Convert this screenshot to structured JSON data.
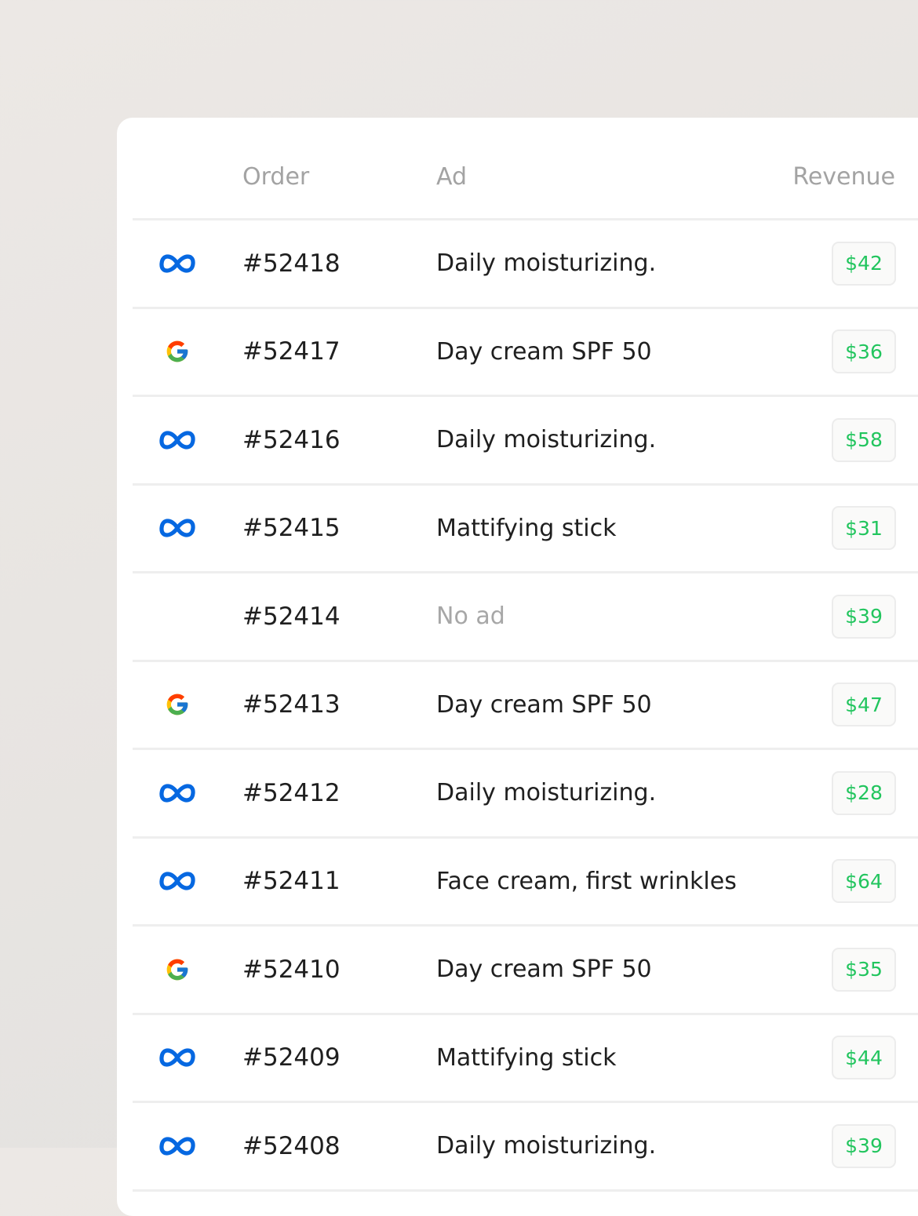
{
  "table": {
    "headers": {
      "order": "Order",
      "ad": "Ad",
      "revenue": "Revenue"
    },
    "rows": [
      {
        "source": "meta-icon",
        "order": "#52418",
        "ad": "Daily moisturizing.",
        "revenue": "$42"
      },
      {
        "source": "google-icon",
        "order": "#52417",
        "ad": "Day cream SPF 50",
        "revenue": "$36"
      },
      {
        "source": "meta-icon",
        "order": "#52416",
        "ad": "Daily moisturizing.",
        "revenue": "$58"
      },
      {
        "source": "meta-icon",
        "order": "#52415",
        "ad": "Mattifying stick",
        "revenue": "$31"
      },
      {
        "source": "none",
        "order": "#52414",
        "ad": "No ad",
        "revenue": "$39"
      },
      {
        "source": "google-icon",
        "order": "#52413",
        "ad": "Day cream SPF 50",
        "revenue": "$47"
      },
      {
        "source": "meta-icon",
        "order": "#52412",
        "ad": "Daily moisturizing.",
        "revenue": "$28"
      },
      {
        "source": "meta-icon",
        "order": "#52411",
        "ad": "Face cream, first wrinkles",
        "revenue": "$64"
      },
      {
        "source": "google-icon",
        "order": "#52410",
        "ad": "Day cream SPF 50",
        "revenue": "$35"
      },
      {
        "source": "meta-icon",
        "order": "#52409",
        "ad": "Mattifying stick",
        "revenue": "$44"
      },
      {
        "source": "meta-icon",
        "order": "#52408",
        "ad": "Daily moisturizing.",
        "revenue": "$39"
      }
    ]
  },
  "colors": {
    "meta_blue": "#0668E1",
    "revenue_green": "#22c55e",
    "muted_text": "#a3a3a3"
  }
}
